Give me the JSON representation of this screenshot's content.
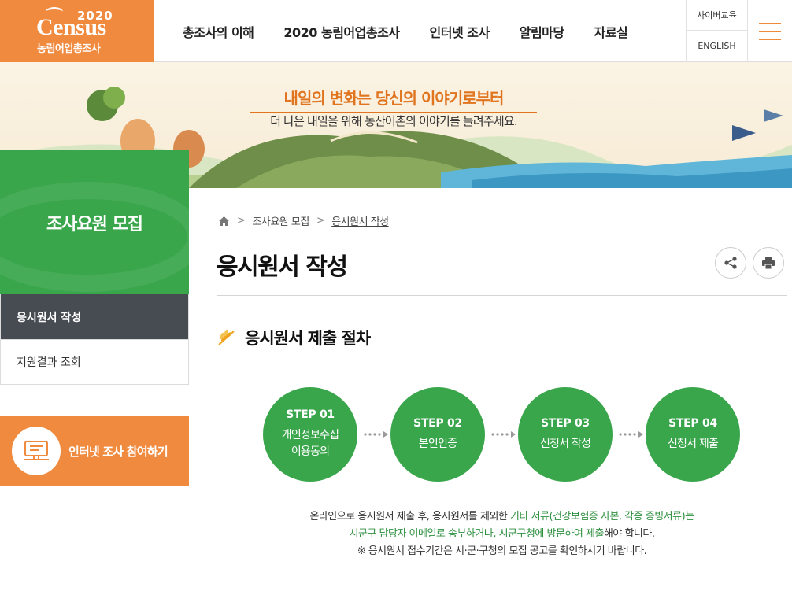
{
  "header": {
    "logo_year": "2020",
    "logo_word": "Census",
    "logo_sub": "농림어업총조사",
    "nav": [
      "총조사의 이해",
      "2020 농림어업총조사",
      "인터넷 조사",
      "알림마당",
      "자료실"
    ],
    "util": [
      "사이버교육",
      "ENGLISH"
    ]
  },
  "banner": {
    "title": "내일의 변화는 당신의 이야기로부터",
    "subtitle": "더 나은 내일을 위해 농산어촌의 이야기를 들려주세요."
  },
  "sidebar": {
    "title": "조사요원 모집",
    "items": [
      {
        "label": "응시원서 작성",
        "active": true
      },
      {
        "label": "지원결과 조회",
        "active": false
      }
    ],
    "cta": "인터넷 조사 참여하기"
  },
  "breadcrumb": [
    "조사요원 모집",
    "응시원서 작성"
  ],
  "page_title": "응시원서 작성",
  "section_title": "응시원서 제출 절차",
  "steps": [
    {
      "num": "STEP 01",
      "name_1": "개인정보수집",
      "name_2": "이용동의"
    },
    {
      "num": "STEP 02",
      "name_1": "본인인증",
      "name_2": ""
    },
    {
      "num": "STEP 03",
      "name_1": "신청서 작성",
      "name_2": ""
    },
    {
      "num": "STEP 04",
      "name_1": "신청서 제출",
      "name_2": ""
    }
  ],
  "notice": {
    "l1_a": "온라인으로 응시원서 제출 후, 응시원서를 제외한 ",
    "l1_b": "기타 서류(건강보험증 사본, 각종 증빙서류)는",
    "l2_a": "시군구 담당자 이메일로 송부하거나, 시군구청에 방문하여 제출",
    "l2_b": "해야 합니다.",
    "l3": "※ 응시원서 접수기간은 시·군·구청의 모집 공고를 확인하시기 바랍니다."
  },
  "colors": {
    "brand_orange": "#f08a3e",
    "brand_green": "#3aa64c",
    "dark_gray": "#474c52"
  }
}
